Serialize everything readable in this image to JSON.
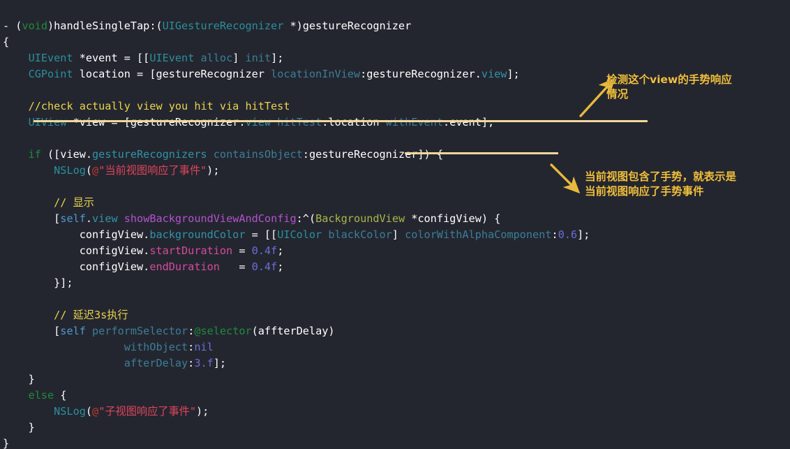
{
  "editor": {
    "background_color": "#24262f",
    "default_text_color": "#ffffff",
    "language": "Objective-C",
    "font_size_px": 15,
    "line_height_px": 23
  },
  "palette": {
    "keyword": "#1f8a3e",
    "type": "#2a8f9d",
    "message_selector": "#3a7f99",
    "property": "#2f94a8",
    "self_keyword": "#4c9ad4",
    "number": "#6a6ed8",
    "string": "#e0445c",
    "comment": "#e8d44d",
    "custom_class": "#a9b54a",
    "method_name": "#b352cf",
    "duration_property": "#d54b9e",
    "annotation": "#f0c040",
    "underline": "#f3d79b"
  },
  "code": {
    "lines": [
      "- (void)handleSingleTap:(UIGestureRecognizer *)gestureRecognizer",
      "{",
      "    UIEvent *event = [[UIEvent alloc] init];",
      "    CGPoint location = [gestureRecognizer locationInView:gestureRecognizer.view];",
      "",
      "    //check actually view you hit via hitTest",
      "    UIView *view = [gestureRecognizer.view hitTest:location withEvent:event];",
      "",
      "    if ([view.gestureRecognizers containsObject:gestureRecognizer]) {",
      "        NSLog(@\"当前视图响应了事件\");",
      "",
      "        // 显示",
      "        [self.view showBackgroundViewAndConfig:^(BackgroundView *configView) {",
      "            configView.backgroundColor = [[UIColor blackColor] colorWithAlphaComponent:0.6];",
      "            configView.startDuration = 0.4f;",
      "            configView.endDuration   = 0.4f;",
      "        }];",
      "",
      "        // 延迟3s执行",
      "        [self performSelector:@selector(affterDelay)",
      "                   withObject:nil",
      "                   afterDelay:3.f];",
      "    }",
      "    else {",
      "        NSLog(@\"子视图响应了事件\");",
      "    }",
      "}"
    ],
    "comments": [
      "//check actually view you hit via hitTest",
      "// 显示",
      "// 延迟3s执行"
    ],
    "strings": [
      "@\"当前视图响应了事件\"",
      "@\"子视图响应了事件\""
    ],
    "numbers": [
      "0.6",
      "0.4f",
      "0.4f",
      "3.f"
    ],
    "method_signature": "- (void)handleSingleTap:(UIGestureRecognizer *)gestureRecognizer"
  },
  "annotations": [
    {
      "id": "annotation-hit-test",
      "text": "检测这个view的手势响应\n情况",
      "arrow": "arrow-up-right",
      "target_line": "UIView *view = [gestureRecognizer.view hitTest:location withEvent:event];"
    },
    {
      "id": "annotation-contains-gesture",
      "text": "当前视图包含了手势，就表示是\n当前视图响应了手势事件",
      "arrow": "arrow-down-right",
      "target_line": "if ([view.gestureRecognizers containsObject:gestureRecognizer]) {"
    }
  ],
  "highlights": [
    {
      "id": "underline-hittest-line",
      "label": "UIView *view = [gestureRecognizer.view hitTest:location withEvent:event];"
    },
    {
      "id": "underline-gesture-recognizer-arg",
      "label": "gestureRecognizer])"
    }
  ]
}
